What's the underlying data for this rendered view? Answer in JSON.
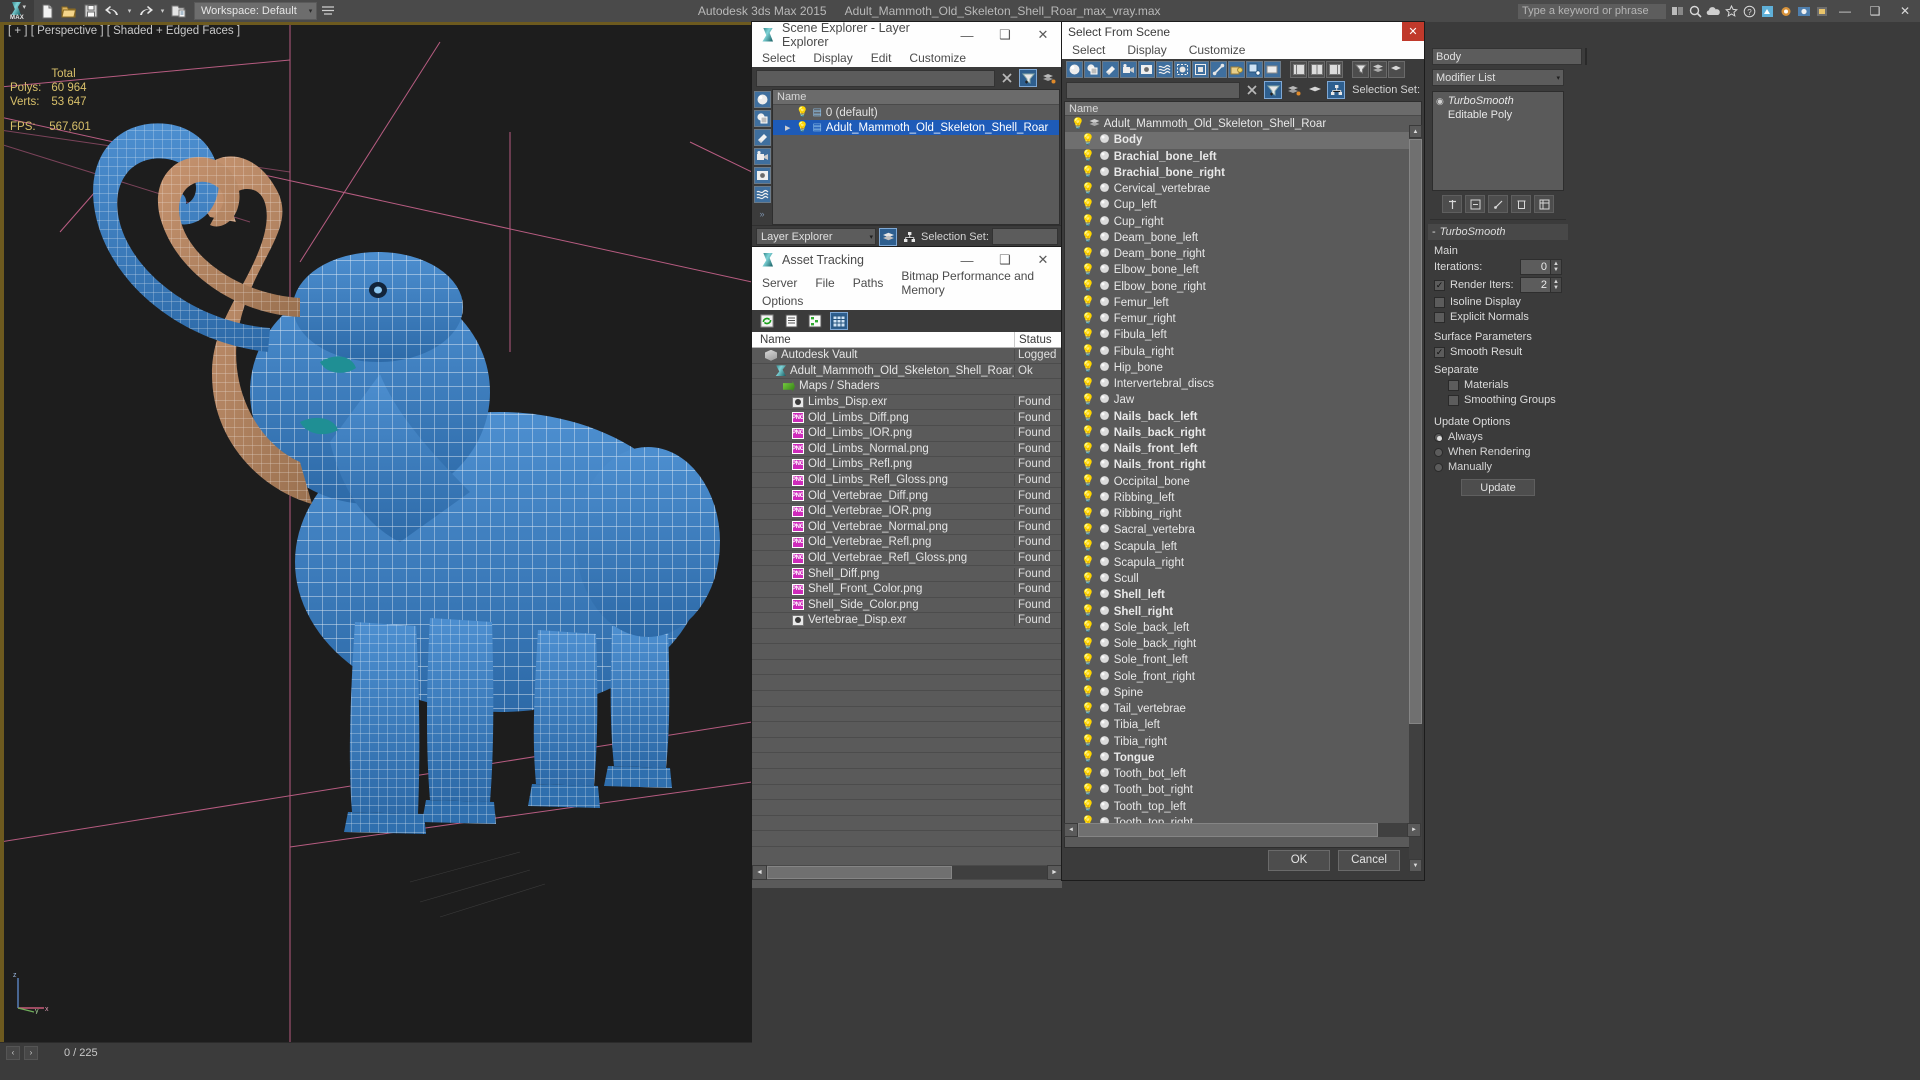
{
  "titlebar": {
    "workspace_label": "Workspace: Default",
    "app_title": "Autodesk 3ds Max  2015",
    "file_title": "Adult_Mammoth_Old_Skeleton_Shell_Roar_max_vray.max",
    "search_placeholder": "Type a keyword or phrase",
    "minimize": "—",
    "maximize": "❑",
    "close": "✕"
  },
  "viewport": {
    "label": "[ + ] [ Perspective ] [ Shaded + Edged Faces ]",
    "stats": {
      "total_header": "Total",
      "polys_label": "Polys:",
      "polys_value": "60 964",
      "verts_label": "Verts:",
      "verts_value": "53 647",
      "fps_label": "FPS:",
      "fps_value": "567,601"
    },
    "mesh_color": "#3d7fc1",
    "tusk_color": "#b08260",
    "background": "#1d1d1d"
  },
  "statusbar": {
    "frame_counter": "0 / 225"
  },
  "scene_explorer": {
    "window_title": "Scene Explorer - Layer Explorer",
    "menus": [
      "Select",
      "Display",
      "Edit",
      "Customize"
    ],
    "filter_value": "",
    "column_header": "Name",
    "rows": [
      {
        "name": "0 (default)",
        "selected": false,
        "expandable": false
      },
      {
        "name": "Adult_Mammoth_Old_Skeleton_Shell_Roar",
        "selected": true,
        "expandable": true
      }
    ],
    "footer": {
      "mode_label": "Layer Explorer",
      "selection_set_label": "Selection Set:",
      "selection_set_value": ""
    },
    "win_buttons": {
      "min": "—",
      "max": "❑",
      "close": "✕"
    }
  },
  "asset_tracking": {
    "window_title": "Asset Tracking",
    "menus_row1": [
      "Server",
      "File",
      "Paths",
      "Bitmap Performance and Memory"
    ],
    "menus_row2": [
      "Options"
    ],
    "columns": {
      "name": "Name",
      "status": "Status"
    },
    "rows": [
      {
        "name": "Autodesk Vault",
        "status": "Logged",
        "icon": "vault-icon",
        "indent": 1
      },
      {
        "name": "Adult_Mammoth_Old_Skeleton_Shell_Roar_max_ma...",
        "status": "Ok",
        "icon": "max-file-icon",
        "indent": 2
      },
      {
        "name": "Maps / Shaders",
        "status": "",
        "icon": "maps-shaders-icon",
        "indent": 3
      },
      {
        "name": "Limbs_Disp.exr",
        "status": "Found",
        "icon": "exr-icon",
        "indent": 4
      },
      {
        "name": "Old_Limbs_Diff.png",
        "status": "Found",
        "icon": "png-icon",
        "indent": 4
      },
      {
        "name": "Old_Limbs_IOR.png",
        "status": "Found",
        "icon": "png-icon",
        "indent": 4
      },
      {
        "name": "Old_Limbs_Normal.png",
        "status": "Found",
        "icon": "png-icon",
        "indent": 4
      },
      {
        "name": "Old_Limbs_Refl.png",
        "status": "Found",
        "icon": "png-icon",
        "indent": 4
      },
      {
        "name": "Old_Limbs_Refl_Gloss.png",
        "status": "Found",
        "icon": "png-icon",
        "indent": 4
      },
      {
        "name": "Old_Vertebrae_Diff.png",
        "status": "Found",
        "icon": "png-icon",
        "indent": 4
      },
      {
        "name": "Old_Vertebrae_IOR.png",
        "status": "Found",
        "icon": "png-icon",
        "indent": 4
      },
      {
        "name": "Old_Vertebrae_Normal.png",
        "status": "Found",
        "icon": "png-icon",
        "indent": 4
      },
      {
        "name": "Old_Vertebrae_Refl.png",
        "status": "Found",
        "icon": "png-icon",
        "indent": 4
      },
      {
        "name": "Old_Vertebrae_Refl_Gloss.png",
        "status": "Found",
        "icon": "png-icon",
        "indent": 4
      },
      {
        "name": "Shell_Diff.png",
        "status": "Found",
        "icon": "png-icon",
        "indent": 4
      },
      {
        "name": "Shell_Front_Color.png",
        "status": "Found",
        "icon": "png-icon",
        "indent": 4
      },
      {
        "name": "Shell_Side_Color.png",
        "status": "Found",
        "icon": "png-icon",
        "indent": 4
      },
      {
        "name": "Vertebrae_Disp.exr",
        "status": "Found",
        "icon": "exr-icon",
        "indent": 4
      }
    ],
    "blank_row_count": 14,
    "win_buttons": {
      "min": "—",
      "max": "❑",
      "close": "✕"
    }
  },
  "select_from_scene": {
    "window_title": "Select From Scene",
    "close_label": "✕",
    "menus": [
      "Select",
      "Display",
      "Customize"
    ],
    "filter_value": "",
    "selection_set_label": "Selection Set:",
    "column_header": "Name",
    "ok_label": "OK",
    "cancel_label": "Cancel",
    "rows": [
      {
        "name": "Adult_Mammoth_Old_Skeleton_Shell_Roar",
        "bold": false,
        "level": 1,
        "highlight": false
      },
      {
        "name": "Body",
        "bold": true,
        "level": 2,
        "highlight": true
      },
      {
        "name": "Brachial_bone_left",
        "bold": true,
        "level": 2,
        "highlight": false
      },
      {
        "name": "Brachial_bone_right",
        "bold": true,
        "level": 2,
        "highlight": false
      },
      {
        "name": "Cervical_vertebrae",
        "bold": false,
        "level": 2,
        "highlight": false
      },
      {
        "name": "Cup_left",
        "bold": false,
        "level": 2,
        "highlight": false
      },
      {
        "name": "Cup_right",
        "bold": false,
        "level": 2,
        "highlight": false
      },
      {
        "name": "Deam_bone_left",
        "bold": false,
        "level": 2,
        "highlight": false
      },
      {
        "name": "Deam_bone_right",
        "bold": false,
        "level": 2,
        "highlight": false
      },
      {
        "name": "Elbow_bone_left",
        "bold": false,
        "level": 2,
        "highlight": false
      },
      {
        "name": "Elbow_bone_right",
        "bold": false,
        "level": 2,
        "highlight": false
      },
      {
        "name": "Femur_left",
        "bold": false,
        "level": 2,
        "highlight": false
      },
      {
        "name": "Femur_right",
        "bold": false,
        "level": 2,
        "highlight": false
      },
      {
        "name": "Fibula_left",
        "bold": false,
        "level": 2,
        "highlight": false
      },
      {
        "name": "Fibula_right",
        "bold": false,
        "level": 2,
        "highlight": false
      },
      {
        "name": "Hip_bone",
        "bold": false,
        "level": 2,
        "highlight": false
      },
      {
        "name": "Intervertebral_discs",
        "bold": false,
        "level": 2,
        "highlight": false
      },
      {
        "name": "Jaw",
        "bold": false,
        "level": 2,
        "highlight": false
      },
      {
        "name": "Nails_back_left",
        "bold": true,
        "level": 2,
        "highlight": false
      },
      {
        "name": "Nails_back_right",
        "bold": true,
        "level": 2,
        "highlight": false
      },
      {
        "name": "Nails_front_left",
        "bold": true,
        "level": 2,
        "highlight": false
      },
      {
        "name": "Nails_front_right",
        "bold": true,
        "level": 2,
        "highlight": false
      },
      {
        "name": "Occipital_bone",
        "bold": false,
        "level": 2,
        "highlight": false
      },
      {
        "name": "Ribbing_left",
        "bold": false,
        "level": 2,
        "highlight": false
      },
      {
        "name": "Ribbing_right",
        "bold": false,
        "level": 2,
        "highlight": false
      },
      {
        "name": "Sacral_vertebra",
        "bold": false,
        "level": 2,
        "highlight": false
      },
      {
        "name": "Scapula_left",
        "bold": false,
        "level": 2,
        "highlight": false
      },
      {
        "name": "Scapula_right",
        "bold": false,
        "level": 2,
        "highlight": false
      },
      {
        "name": "Scull",
        "bold": false,
        "level": 2,
        "highlight": false
      },
      {
        "name": "Shell_left",
        "bold": true,
        "level": 2,
        "highlight": false
      },
      {
        "name": "Shell_right",
        "bold": true,
        "level": 2,
        "highlight": false
      },
      {
        "name": "Sole_back_left",
        "bold": false,
        "level": 2,
        "highlight": false
      },
      {
        "name": "Sole_back_right",
        "bold": false,
        "level": 2,
        "highlight": false
      },
      {
        "name": "Sole_front_left",
        "bold": false,
        "level": 2,
        "highlight": false
      },
      {
        "name": "Sole_front_right",
        "bold": false,
        "level": 2,
        "highlight": false
      },
      {
        "name": "Spine",
        "bold": false,
        "level": 2,
        "highlight": false
      },
      {
        "name": "Tail_vertebrae",
        "bold": false,
        "level": 2,
        "highlight": false
      },
      {
        "name": "Tibia_left",
        "bold": false,
        "level": 2,
        "highlight": false
      },
      {
        "name": "Tibia_right",
        "bold": false,
        "level": 2,
        "highlight": false
      },
      {
        "name": "Tongue",
        "bold": true,
        "level": 2,
        "highlight": false
      },
      {
        "name": "Tooth_bot_left",
        "bold": false,
        "level": 2,
        "highlight": false
      },
      {
        "name": "Tooth_bot_right",
        "bold": false,
        "level": 2,
        "highlight": false
      },
      {
        "name": "Tooth_top_left",
        "bold": false,
        "level": 2,
        "highlight": false
      },
      {
        "name": "Tooth_top_right",
        "bold": false,
        "level": 2,
        "highlight": false
      }
    ]
  },
  "command_panel": {
    "object_name": "Body",
    "object_color": "#3c6fa8",
    "modifier_list_label": "Modifier List",
    "stack": [
      {
        "name": "TurboSmooth",
        "italic": true
      },
      {
        "name": "Editable Poly",
        "italic": false
      }
    ],
    "rollout": {
      "title": "TurboSmooth",
      "main_label": "Main",
      "iterations_label": "Iterations:",
      "iterations_value": "0",
      "render_iters_label": "Render Iters:",
      "render_iters_value": "2",
      "render_iters_checked": true,
      "isoline_display_label": "Isoline Display",
      "isoline_display_checked": false,
      "explicit_normals_label": "Explicit Normals",
      "explicit_normals_checked": false,
      "surface_params_label": "Surface Parameters",
      "smooth_result_label": "Smooth Result",
      "smooth_result_checked": true,
      "separate_label": "Separate",
      "materials_label": "Materials",
      "materials_checked": false,
      "smoothing_groups_label": "Smoothing Groups",
      "smoothing_groups_checked": false,
      "update_options_label": "Update Options",
      "update_always_label": "Always",
      "update_when_rendering_label": "When Rendering",
      "update_manually_label": "Manually",
      "update_selected": "Always",
      "update_button_label": "Update"
    }
  }
}
